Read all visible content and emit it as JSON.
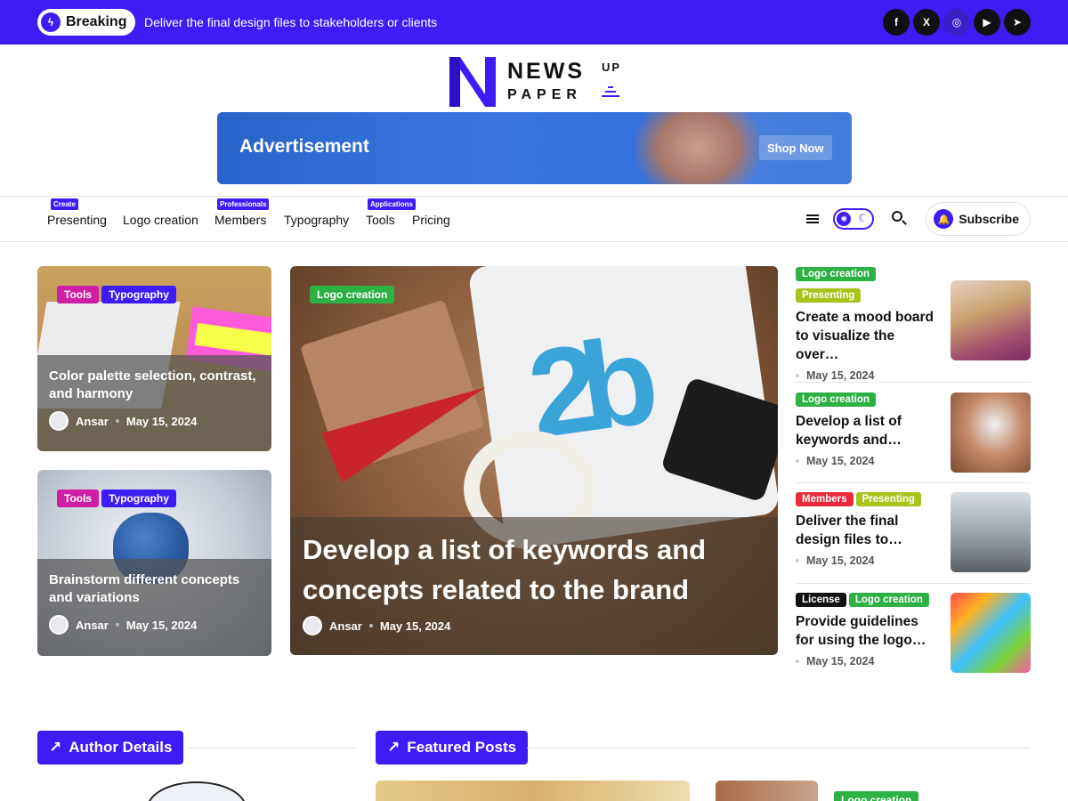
{
  "topbar": {
    "breaking_label": "Breaking",
    "ticker_text": "Deliver the final design files to stakeholders or clients",
    "socials": [
      {
        "name": "facebook-icon",
        "glyph": "f"
      },
      {
        "name": "x-icon",
        "glyph": "X"
      },
      {
        "name": "instagram-icon",
        "glyph": "◎"
      },
      {
        "name": "youtube-icon",
        "glyph": "▶"
      },
      {
        "name": "telegram-icon",
        "glyph": "➤"
      }
    ]
  },
  "logo": {
    "word1": "NEWS",
    "word2": "PAPER",
    "word3": "UP"
  },
  "ad": {
    "title": "Advertisement",
    "button": "Shop Now"
  },
  "nav": {
    "items": [
      {
        "label": "Presenting",
        "badge": "Create"
      },
      {
        "label": "Logo creation",
        "badge": ""
      },
      {
        "label": "Members",
        "badge": "Professionals"
      },
      {
        "label": "Typography",
        "badge": ""
      },
      {
        "label": "Tools",
        "badge": "Applications"
      },
      {
        "label": "Pricing",
        "badge": ""
      }
    ],
    "subscribe": "Subscribe"
  },
  "left_cards": [
    {
      "tags": [
        "Tools",
        "Typography"
      ],
      "title": "Color palette selection, contrast, and harmony",
      "author": "Ansar",
      "date": "May 15, 2024"
    },
    {
      "tags": [
        "Tools",
        "Typography"
      ],
      "title": "Brainstorm different concepts and variations",
      "author": "Ansar",
      "date": "May 15, 2024"
    }
  ],
  "center_card": {
    "tag": "Logo creation",
    "title": "Develop a list of keywords and concepts related to the brand",
    "author": "Ansar",
    "date": "May 15, 2024"
  },
  "sidebar": [
    {
      "tags": [
        "Logo creation",
        "Presenting"
      ],
      "title": "Create a mood board to visualize the over…",
      "date": "May 15, 2024"
    },
    {
      "tags": [
        "Logo creation"
      ],
      "title": "Develop a list of keywords and…",
      "date": "May 15, 2024"
    },
    {
      "tags": [
        "Members",
        "Presenting"
      ],
      "title": "Deliver the final design files to…",
      "date": "May 15, 2024"
    },
    {
      "tags": [
        "License",
        "Logo creation"
      ],
      "title": "Provide guidelines for using the logo…",
      "date": "May 15, 2024"
    }
  ],
  "sections": {
    "author_details": "Author Details",
    "featured_posts": "Featured Posts",
    "peek_tag": "Logo creation"
  },
  "colors": {
    "accent": "#3d1cf5",
    "tag_pink": "#cf1ea4",
    "tag_green": "#2db145",
    "tag_olive": "#a7c41c",
    "tag_red": "#ea2a3b",
    "tag_black": "#111111"
  }
}
